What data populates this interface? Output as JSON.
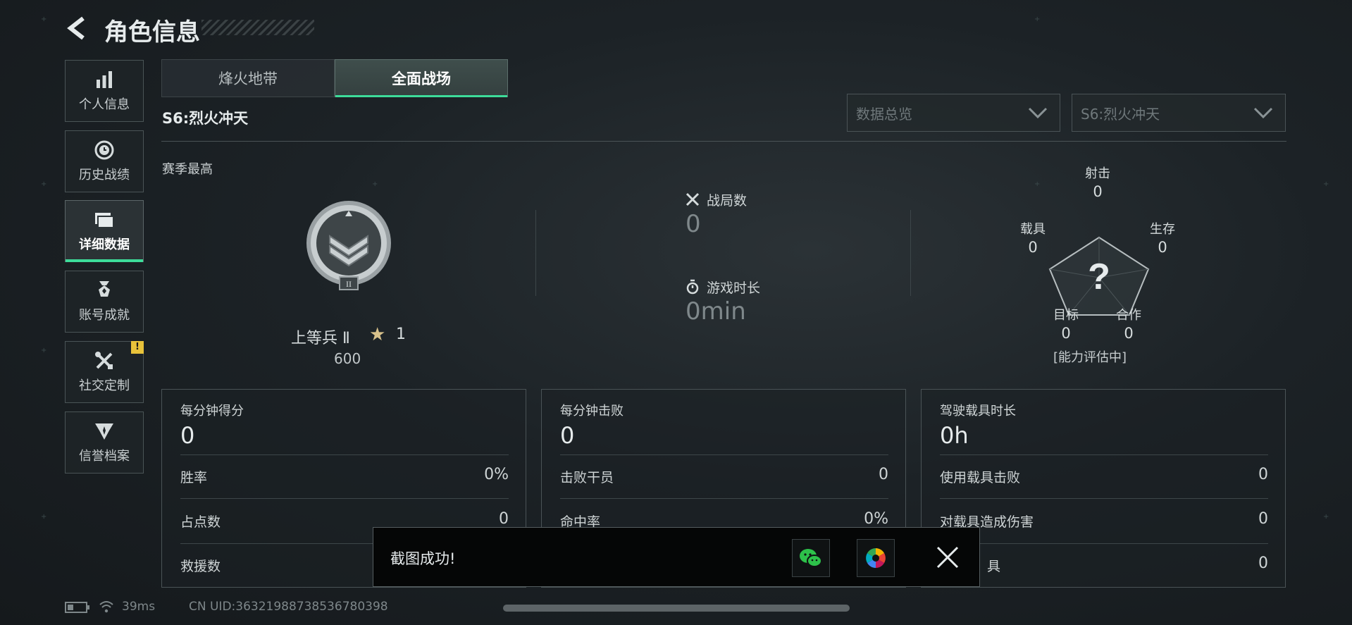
{
  "header": {
    "title": "角色信息",
    "back_icon": "back-arrow-icon"
  },
  "sidebar": {
    "items": [
      {
        "label": "个人信息",
        "icon": "bar-chart-icon"
      },
      {
        "label": "历史战绩",
        "icon": "clock-history-icon"
      },
      {
        "label": "详细数据",
        "icon": "folder-icon",
        "active": true
      },
      {
        "label": "账号成就",
        "icon": "medal-icon"
      },
      {
        "label": "社交定制",
        "icon": "tools-icon",
        "badge": "!"
      },
      {
        "label": "信誉档案",
        "icon": "shield-wings-icon"
      }
    ]
  },
  "tabs": [
    {
      "label": "烽火地带",
      "active": false
    },
    {
      "label": "全面战场",
      "active": true
    }
  ],
  "season_label": "S6:烈火冲天",
  "filters": {
    "data_type": "数据总览",
    "season": "S6:烈火冲天"
  },
  "overview": {
    "section_label": "赛季最高",
    "rank_name": "上等兵 Ⅱ",
    "rank_roman": "II",
    "rank_stars": "1",
    "rank_points": "600",
    "matches_label": "战局数",
    "matches_value": "0",
    "playtime_label": "游戏时长",
    "playtime_value": "0min"
  },
  "radar": {
    "shooting_label": "射击",
    "shooting_value": "0",
    "survival_label": "生存",
    "survival_value": "0",
    "teamwork_label": "合作",
    "teamwork_value": "0",
    "objective_label": "目标",
    "objective_value": "0",
    "vehicle_label": "载具",
    "vehicle_value": "0",
    "center_symbol": "?",
    "status": "[能力评估中]"
  },
  "panels": [
    {
      "title": "每分钟得分",
      "value": "0",
      "rows": [
        {
          "label": "胜率",
          "value": "0%"
        },
        {
          "label": "占点数",
          "value": "0"
        },
        {
          "label": "救援数",
          "value": ""
        }
      ]
    },
    {
      "title": "每分钟击败",
      "value": "0",
      "rows": [
        {
          "label": "击败干员",
          "value": "0"
        },
        {
          "label": "命中率",
          "value": "0%"
        }
      ]
    },
    {
      "title": "驾驶载具时长",
      "value": "0h",
      "rows": [
        {
          "label": "使用载具击败",
          "value": "0"
        },
        {
          "label": "对载具造成伤害",
          "value": "0"
        },
        {
          "label": "具",
          "value": "0"
        }
      ]
    }
  ],
  "toast": {
    "message": "截图成功!",
    "wechat_icon": "wechat-icon",
    "photos_icon": "photos-icon",
    "close_icon": "close-icon"
  },
  "status_bar": {
    "ping": "39ms",
    "uid": "CN UID:36321988738536780398"
  },
  "colors": {
    "accent": "#3ddc9a",
    "badge": "#e8c23a",
    "background": "#1c2226"
  }
}
